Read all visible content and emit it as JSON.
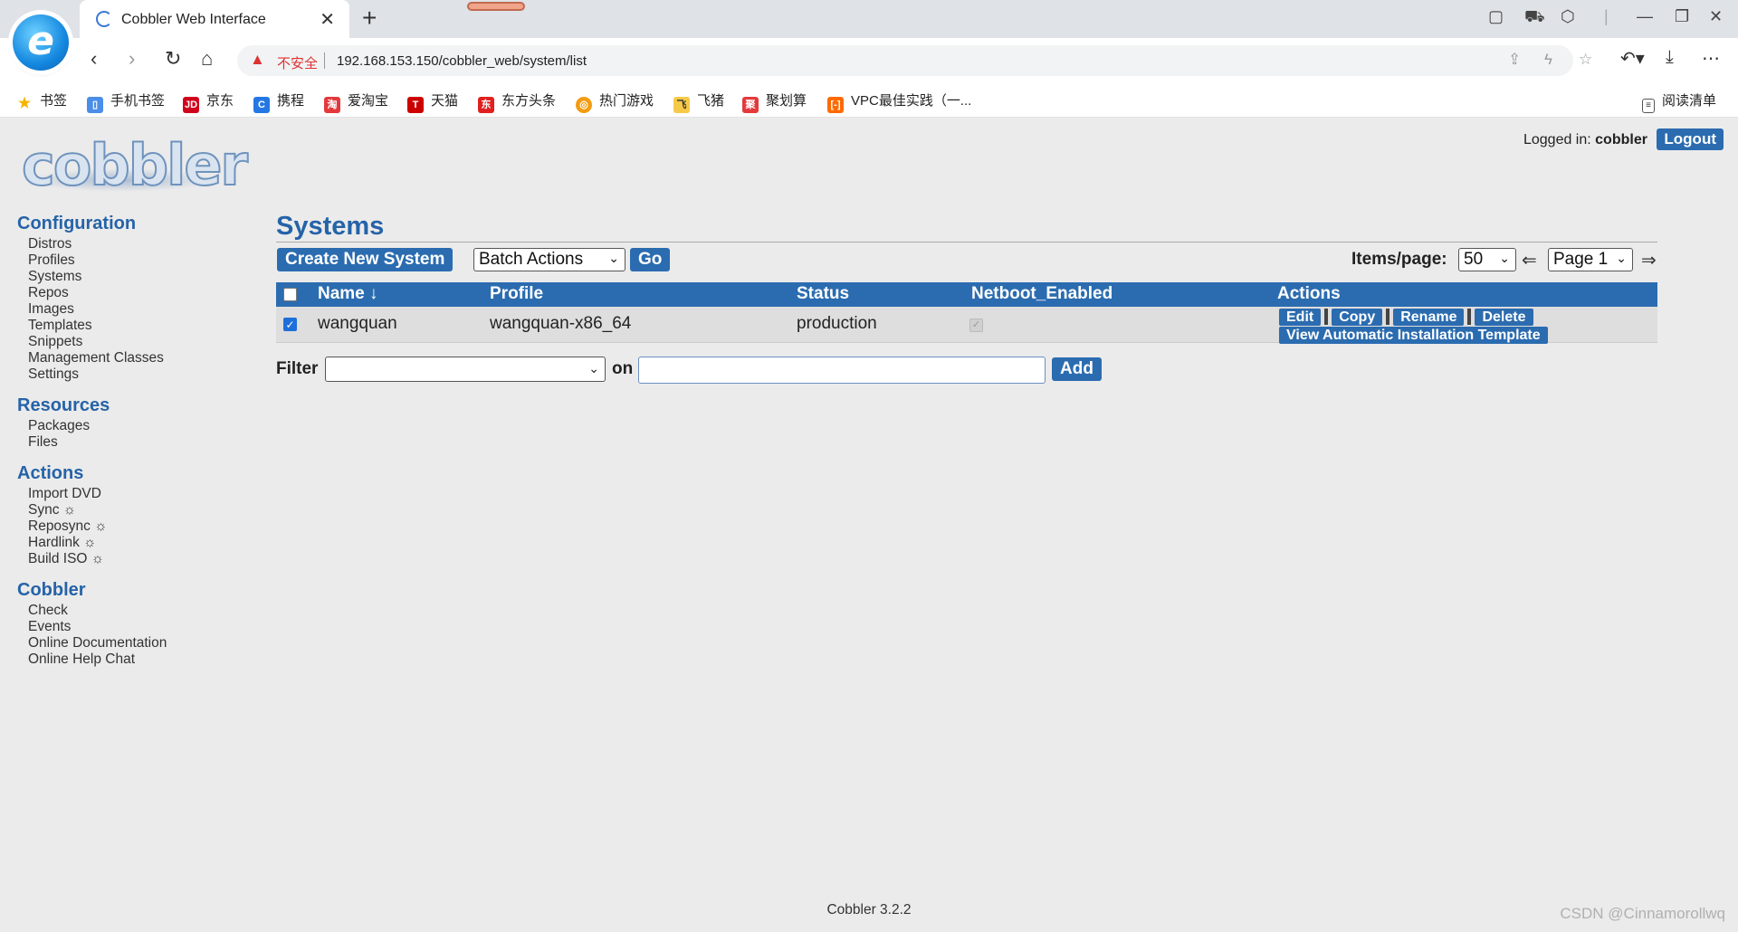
{
  "browser": {
    "tab_title": "Cobbler Web Interface",
    "security_label": "不安全",
    "url": "192.168.153.150/cobbler_web/system/list",
    "bookmarks": [
      "书签",
      "手机书签",
      "京东",
      "携程",
      "爱淘宝",
      "天猫",
      "东方头条",
      "热门游戏",
      "飞猪",
      "聚划算",
      "VPC最佳实践（一..."
    ],
    "reading_list": "阅读清单"
  },
  "header": {
    "logo_text": "cobbler",
    "logged_in_label": "Logged in:",
    "user": "cobbler",
    "logout": "Logout"
  },
  "sidebar": {
    "configuration": {
      "title": "Configuration",
      "items": [
        "Distros",
        "Profiles",
        "Systems",
        "Repos",
        "Images",
        "Templates",
        "Snippets",
        "Management Classes",
        "Settings"
      ]
    },
    "resources": {
      "title": "Resources",
      "items": [
        "Packages",
        "Files"
      ]
    },
    "actions": {
      "title": "Actions",
      "items": [
        "Import DVD",
        "Sync ☼",
        "Reposync ☼",
        "Hardlink ☼",
        "Build ISO ☼"
      ]
    },
    "cobbler": {
      "title": "Cobbler",
      "items": [
        "Check",
        "Events",
        "Online Documentation",
        "Online Help Chat"
      ]
    }
  },
  "main": {
    "title": "Systems",
    "create_button": "Create New System",
    "batch_actions": "Batch Actions",
    "go_button": "Go",
    "items_per_page_label": "Items/page:",
    "items_per_page": "50",
    "page": "Page 1",
    "prev_arrow": "⇐",
    "next_arrow": "⇒",
    "columns": [
      "Name ↓",
      "Profile",
      "Status",
      "Netboot_Enabled",
      "Actions"
    ],
    "rows": [
      {
        "name": "wangquan",
        "profile": "wangquan-x86_64",
        "status": "production",
        "netboot_enabled": true,
        "selected": true,
        "actions": [
          "Edit",
          "Copy",
          "Rename",
          "Delete"
        ],
        "template_action": "View Automatic Installation Template"
      }
    ],
    "filter_label": "Filter",
    "filter_on": "on",
    "filter_value": "",
    "add_button": "Add"
  },
  "footer": {
    "version": "Cobbler 3.2.2",
    "watermark": "CSDN @Cinnamorollwq"
  },
  "colors": {
    "accent": "#2b6cb0",
    "heading": "#2563a8",
    "background": "#ebebeb"
  }
}
